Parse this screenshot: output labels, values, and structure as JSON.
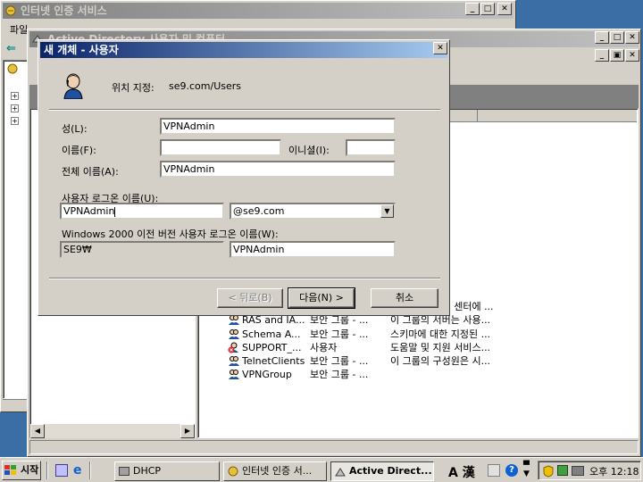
{
  "outer_window": {
    "title": "인터넷 인증 서비스",
    "menu_first": "파일"
  },
  "ad_window": {
    "title": "Active Directory 사용자 및 컴퓨터"
  },
  "list_rows": [
    {
      "col1": "",
      "col2": "",
      "col3": "리..."
    },
    {
      "col1": "",
      "col2": "",
      "col3": "Act..."
    },
    {
      "col1": "",
      "col2": "",
      "col3": "..."
    },
    {
      "col1": "",
      "col2": "",
      "col3": "오..."
    },
    {
      "col1": "",
      "col2": "",
      "col3": "그룹"
    },
    {
      "col1": "",
      "col2": "",
      "col3": "다..."
    },
    {
      "col1": "",
      "col2": "",
      "col3": "리자"
    },
    {
      "col1": "",
      "col2": "",
      "col3": "든 ..."
    },
    {
      "col1": "",
      "col2": "",
      "col3": "컨..."
    },
    {
      "col1": "",
      "col2": "",
      "col3": "도..."
    },
    {
      "col1": "",
      "col2": "",
      "col3": "제..."
    },
    {
      "col1": "HelpServic...",
      "col2": "보안 그룹 - ...",
      "col3": "도움말 및 지원 센터에 ..."
    },
    {
      "col1": "RAS and IA...",
      "col2": "보안 그룹 - ...",
      "col3": "이 그룹의 서버는 사용..."
    },
    {
      "col1": "Schema A...",
      "col2": "보안 그룹 - ...",
      "col3": "스키마에 대한 지정된 ..."
    },
    {
      "col1": "SUPPORT_...",
      "col2": "사용자",
      "col3": "도움말 및 지원 서비스..."
    },
    {
      "col1": "TelnetClients",
      "col2": "보안 그룹 - ...",
      "col3": "이 그룹의 구성원은 시..."
    },
    {
      "col1": "VPNGroup",
      "col2": "보안 그룹 - ...",
      "col3": ""
    }
  ],
  "dialog": {
    "title": "새 개체 - 사용자",
    "location_label": "위치 지정:",
    "location_value": "se9.com/Users",
    "last_name_label": "성(L):",
    "last_name_value": "VPNAdmin",
    "first_name_label": "이름(F):",
    "first_name_value": "",
    "initials_label": "이니셜(I):",
    "initials_value": "",
    "full_name_label": "전체 이름(A):",
    "full_name_value": "VPNAdmin",
    "logon_label": "사용자 로그온 이름(U):",
    "logon_value": "VPNAdmin",
    "domain_value": "@se9.com",
    "pre2000_label": "Windows 2000 이전 버전 사용자 로그온 이름(W):",
    "pre2000_domain": "SE9₩",
    "pre2000_value": "VPNAdmin",
    "back_label": "< 뒤로(B)",
    "next_label": "다음(N) >",
    "cancel_label": "취소"
  },
  "taskbar": {
    "start_label": "시작",
    "tasks": [
      "DHCP",
      "인터넷 인증 서...",
      "Active Direct..."
    ],
    "ime_label": "A 漢",
    "clock": "오후 12:18"
  }
}
